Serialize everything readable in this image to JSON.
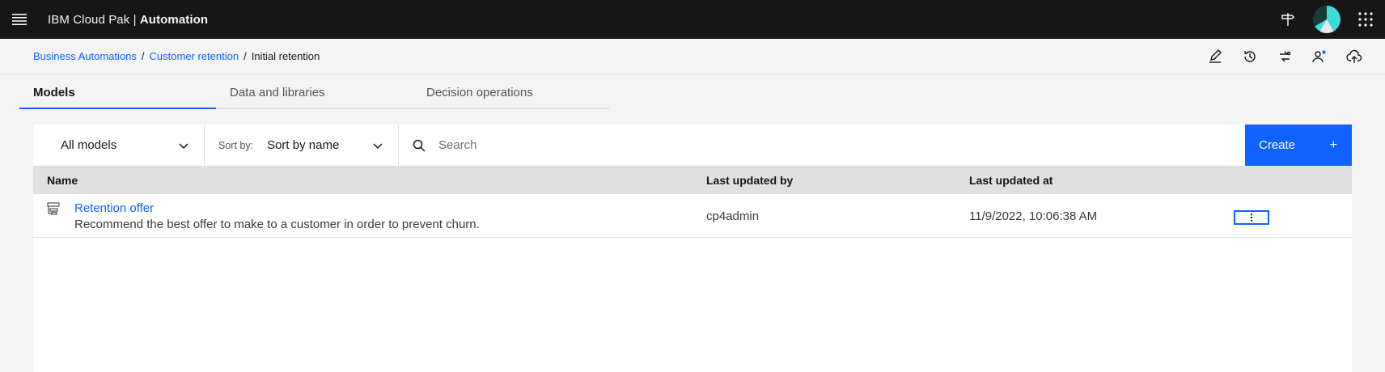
{
  "header": {
    "brand_prefix": "IBM Cloud Pak | ",
    "brand_product": "Automation"
  },
  "breadcrumb": {
    "items": [
      "Business Automations",
      "Customer retention"
    ],
    "current": "Initial retention",
    "separator": "/"
  },
  "tabs": [
    {
      "label": "Models",
      "active": true
    },
    {
      "label": "Data and libraries",
      "active": false
    },
    {
      "label": "Decision operations",
      "active": false
    }
  ],
  "toolbar": {
    "filter_value": "All models",
    "sort_label": "Sort by:",
    "sort_value": "Sort by name",
    "search_placeholder": "Search",
    "create_label": "Create",
    "create_icon": "+"
  },
  "table": {
    "columns": [
      "Name",
      "Last updated by",
      "Last updated at"
    ],
    "rows": [
      {
        "name": "Retention offer",
        "description": "Recommend the best offer to make to a customer in order to prevent churn.",
        "updated_by": "cp4admin",
        "updated_at": "11/9/2022, 10:06:38 AM"
      }
    ]
  },
  "colors": {
    "accent": "#0f62fe",
    "topbar": "#161616",
    "background": "#f4f4f4"
  }
}
